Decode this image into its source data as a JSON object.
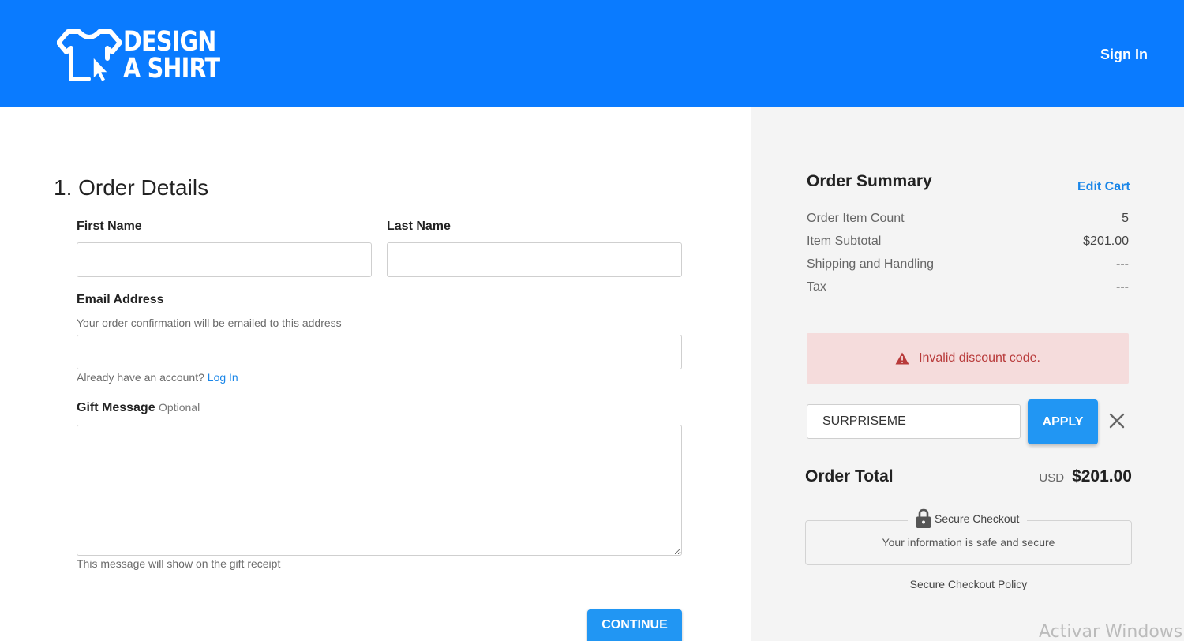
{
  "header": {
    "logo_line1": "DESIGN",
    "logo_line2": "A SHIRT",
    "logo_icon": "tshirt-cursor-icon",
    "sign_in": "Sign In",
    "bg_color": "#0a7bff"
  },
  "order_details": {
    "title": "1. Order Details",
    "first_name_label": "First Name",
    "first_name_value": "",
    "last_name_label": "Last Name",
    "last_name_value": "",
    "email_label": "Email Address",
    "email_hint": "Your order confirmation will be emailed to this address",
    "email_value": "",
    "account_prompt": "Already have an account?",
    "login_link": "Log In",
    "gift_label": "Gift Message",
    "gift_optional": "Optional",
    "gift_value": "",
    "gift_hint": "This message will show on the gift receipt",
    "continue_label": "CONTINUE"
  },
  "summary": {
    "title": "Order Summary",
    "edit_cart": "Edit Cart",
    "rows": [
      {
        "label": "Order Item Count",
        "value": "5"
      },
      {
        "label": "Item Subtotal",
        "value": "$201.00"
      },
      {
        "label": "Shipping and Handling",
        "value": "---"
      },
      {
        "label": "Tax",
        "value": "---"
      }
    ],
    "alert_icon": "warning-icon",
    "alert_text": "Invalid discount code.",
    "discount_value": "SURPRISEME",
    "apply_label": "APPLY",
    "total_label": "Order Total",
    "total_currency": "USD",
    "total_value": "$201.00",
    "secure_title": "Secure Checkout",
    "secure_text": "Your information is safe and secure",
    "policy_link": "Secure Checkout Policy"
  },
  "watermark": "Activar Windows",
  "colors": {
    "accent": "#2196f3",
    "link": "#1a86e8",
    "alert_bg": "#f5dcdc",
    "alert_text": "#b83a3a",
    "panel_bg": "#f4f4f4"
  }
}
